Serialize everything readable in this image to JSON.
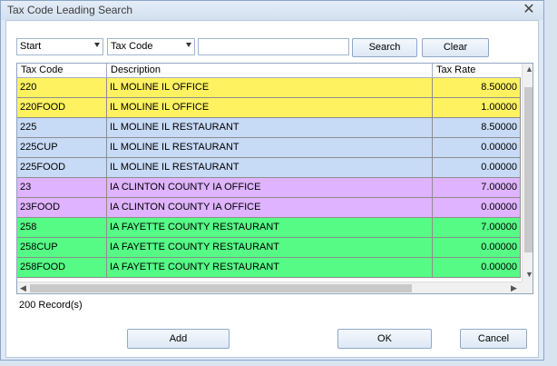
{
  "window": {
    "title": "Tax Code Leading Search",
    "close_glyph": "✕"
  },
  "filters": {
    "match_mode": "Start",
    "field": "Tax Code",
    "search_value": "",
    "search_label": "Search",
    "clear_label": "Clear"
  },
  "grid": {
    "headers": [
      "Tax Code",
      "Description",
      "Tax Rate"
    ],
    "rows": [
      {
        "code": "220",
        "description": "IL MOLINE IL OFFICE",
        "rate": "8.50000",
        "color": "#fff261"
      },
      {
        "code": "220FOOD",
        "description": "IL MOLINE IL OFFICE",
        "rate": "1.00000",
        "color": "#fff261"
      },
      {
        "code": "225",
        "description": "IL MOLINE IL RESTAURANT",
        "rate": "8.50000",
        "color": "#c7daf6"
      },
      {
        "code": "225CUP",
        "description": "IL MOLINE IL RESTAURANT",
        "rate": "0.00000",
        "color": "#c7daf6"
      },
      {
        "code": "225FOOD",
        "description": "IL MOLINE IL RESTAURANT",
        "rate": "0.00000",
        "color": "#c7daf6"
      },
      {
        "code": "23",
        "description": "IA CLINTON COUNTY IA OFFICE",
        "rate": "7.00000",
        "color": "#dfb3ff"
      },
      {
        "code": "23FOOD",
        "description": "IA CLINTON COUNTY IA OFFICE",
        "rate": "0.00000",
        "color": "#dfb3ff"
      },
      {
        "code": "258",
        "description": "IA FAYETTE COUNTY RESTAURANT",
        "rate": "7.00000",
        "color": "#56fb86"
      },
      {
        "code": "258CUP",
        "description": "IA FAYETTE COUNTY RESTAURANT",
        "rate": "0.00000",
        "color": "#56fb86"
      },
      {
        "code": "258FOOD",
        "description": "IA FAYETTE COUNTY RESTAURANT",
        "rate": "0.00000",
        "color": "#56fb86"
      }
    ]
  },
  "status": {
    "records": "200 Record(s)"
  },
  "footer": {
    "add_label": "Add",
    "ok_label": "OK",
    "cancel_label": "Cancel"
  }
}
